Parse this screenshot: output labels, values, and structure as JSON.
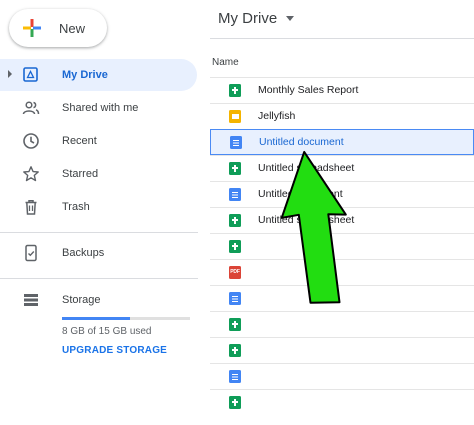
{
  "new_button": {
    "label": "New"
  },
  "sidebar": {
    "items": [
      {
        "label": "My Drive",
        "icon": "my-drive-icon",
        "active": true
      },
      {
        "label": "Shared with me",
        "icon": "people-icon",
        "active": false
      },
      {
        "label": "Recent",
        "icon": "clock-icon",
        "active": false
      },
      {
        "label": "Starred",
        "icon": "star-icon",
        "active": false
      },
      {
        "label": "Trash",
        "icon": "trash-icon",
        "active": false
      },
      {
        "label": "Backups",
        "icon": "phone-icon",
        "active": false
      },
      {
        "label": "Storage",
        "icon": "storage-icon",
        "active": false
      }
    ],
    "storage": {
      "used_text": "8 GB of 15 GB used",
      "used_fraction": 0.533,
      "upgrade_label": "UPGRADE STORAGE"
    }
  },
  "main": {
    "title": "My Drive",
    "column_header": "Name",
    "files": [
      {
        "name": "Monthly Sales Report",
        "type": "sheet"
      },
      {
        "name": "Jellyfish",
        "type": "slides"
      },
      {
        "name": "Untitled document",
        "type": "doc",
        "selected": true
      },
      {
        "name": "Untitled spreadsheet",
        "type": "sheet"
      },
      {
        "name": "Untitled document",
        "type": "doc"
      },
      {
        "name": "Untitled spreadsheet",
        "type": "sheet"
      },
      {
        "name": "",
        "type": "sheet"
      },
      {
        "name": "",
        "type": "pdf"
      },
      {
        "name": "",
        "type": "doc"
      },
      {
        "name": "",
        "type": "sheet"
      },
      {
        "name": "",
        "type": "sheet"
      },
      {
        "name": "",
        "type": "doc"
      },
      {
        "name": "",
        "type": "sheet"
      }
    ],
    "pdf_label": "PDF"
  },
  "colors": {
    "accent": "#1967d2",
    "selected_bg": "#e8f0fe",
    "arrow": "#22dd11",
    "sheet": "#0f9d58",
    "doc": "#4285f4",
    "slides": "#f4b400",
    "pdf": "#db4437"
  }
}
